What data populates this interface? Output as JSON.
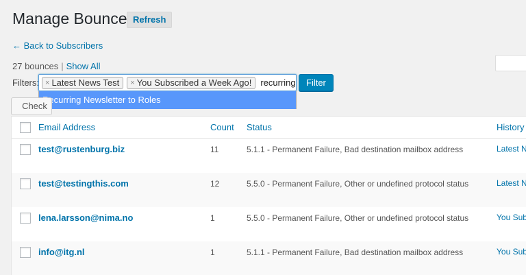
{
  "header": {
    "title": "Manage Bounces",
    "refresh_label": "Refresh"
  },
  "nav": {
    "back_label": "← Back to Subscribers"
  },
  "summary": {
    "count_text": "27 bounces",
    "separator": "|",
    "show_all_label": "Show All"
  },
  "filters": {
    "label": "Filters:",
    "tags": [
      "Latest News Test",
      "You Subscribed a Week Ago!"
    ],
    "typed_value": "recurring",
    "suggestion": "Recurring Newsletter to Roles",
    "filter_button_label": "Filter"
  },
  "bulk": {
    "check_button_label": "Check"
  },
  "table": {
    "columns": {
      "email": "Email Address",
      "count": "Count",
      "status": "Status",
      "history": "History"
    },
    "rows": [
      {
        "email": "test@rustenburg.biz",
        "count": "11",
        "status": "5.1.1 - Permanent Failure, Bad destination mailbox address",
        "history": "Latest N"
      },
      {
        "email": "test@testingthis.com",
        "count": "12",
        "status": "5.5.0 - Permanent Failure, Other or undefined protocol status",
        "history": "Latest N"
      },
      {
        "email": "lena.larsson@nima.no",
        "count": "1",
        "status": "5.5.0 - Permanent Failure, Other or undefined protocol status",
        "history": "You Subs"
      },
      {
        "email": "info@itg.nl",
        "count": "1",
        "status": "5.1.1 - Permanent Failure, Bad destination mailbox address",
        "history": "You Subs"
      }
    ]
  },
  "colors": {
    "link": "#0073aa",
    "primary_button": "#0085ba",
    "suggestion_highlight": "#5897fb"
  }
}
